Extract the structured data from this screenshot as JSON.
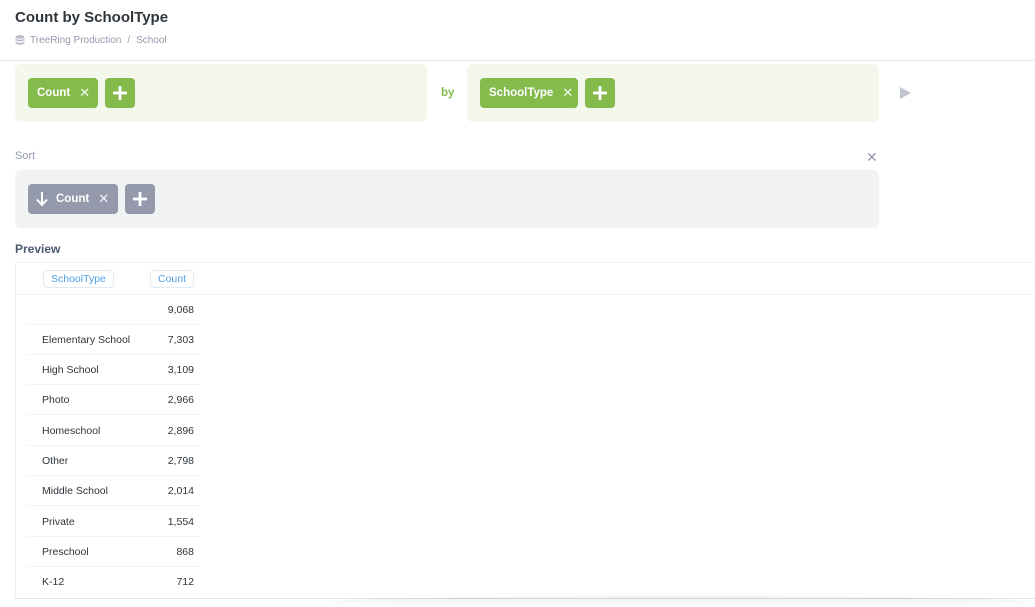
{
  "header": {
    "title": "Count by SchoolType",
    "database": "TreeRing Production",
    "separator": "/",
    "table": "School"
  },
  "summarize": {
    "metric_label": "Count",
    "by_label": "by",
    "breakout_label": "SchoolType"
  },
  "sort": {
    "label": "Sort",
    "field_label": "Count",
    "direction": "descending"
  },
  "preview": {
    "label": "Preview",
    "columns": [
      "SchoolType",
      "Count"
    ],
    "rows": [
      {
        "type": "",
        "count": "9,068"
      },
      {
        "type": "Elementary School",
        "count": "7,303"
      },
      {
        "type": "High School",
        "count": "3,109"
      },
      {
        "type": "Photo",
        "count": "2,966"
      },
      {
        "type": "Homeschool",
        "count": "2,896"
      },
      {
        "type": "Other",
        "count": "2,798"
      },
      {
        "type": "Middle School",
        "count": "2,014"
      },
      {
        "type": "Private",
        "count": "1,554"
      },
      {
        "type": "Preschool",
        "count": "868"
      },
      {
        "type": "K-12",
        "count": "712"
      }
    ]
  },
  "icons": {
    "remove": "close-icon",
    "add": "plus-icon",
    "run": "play-icon",
    "database": "database-icon",
    "sort_direction": "arrow-down-icon"
  },
  "colors": {
    "accent_green": "#84bb4c",
    "accent_gray": "#949aab",
    "link_blue": "#509ee3"
  }
}
